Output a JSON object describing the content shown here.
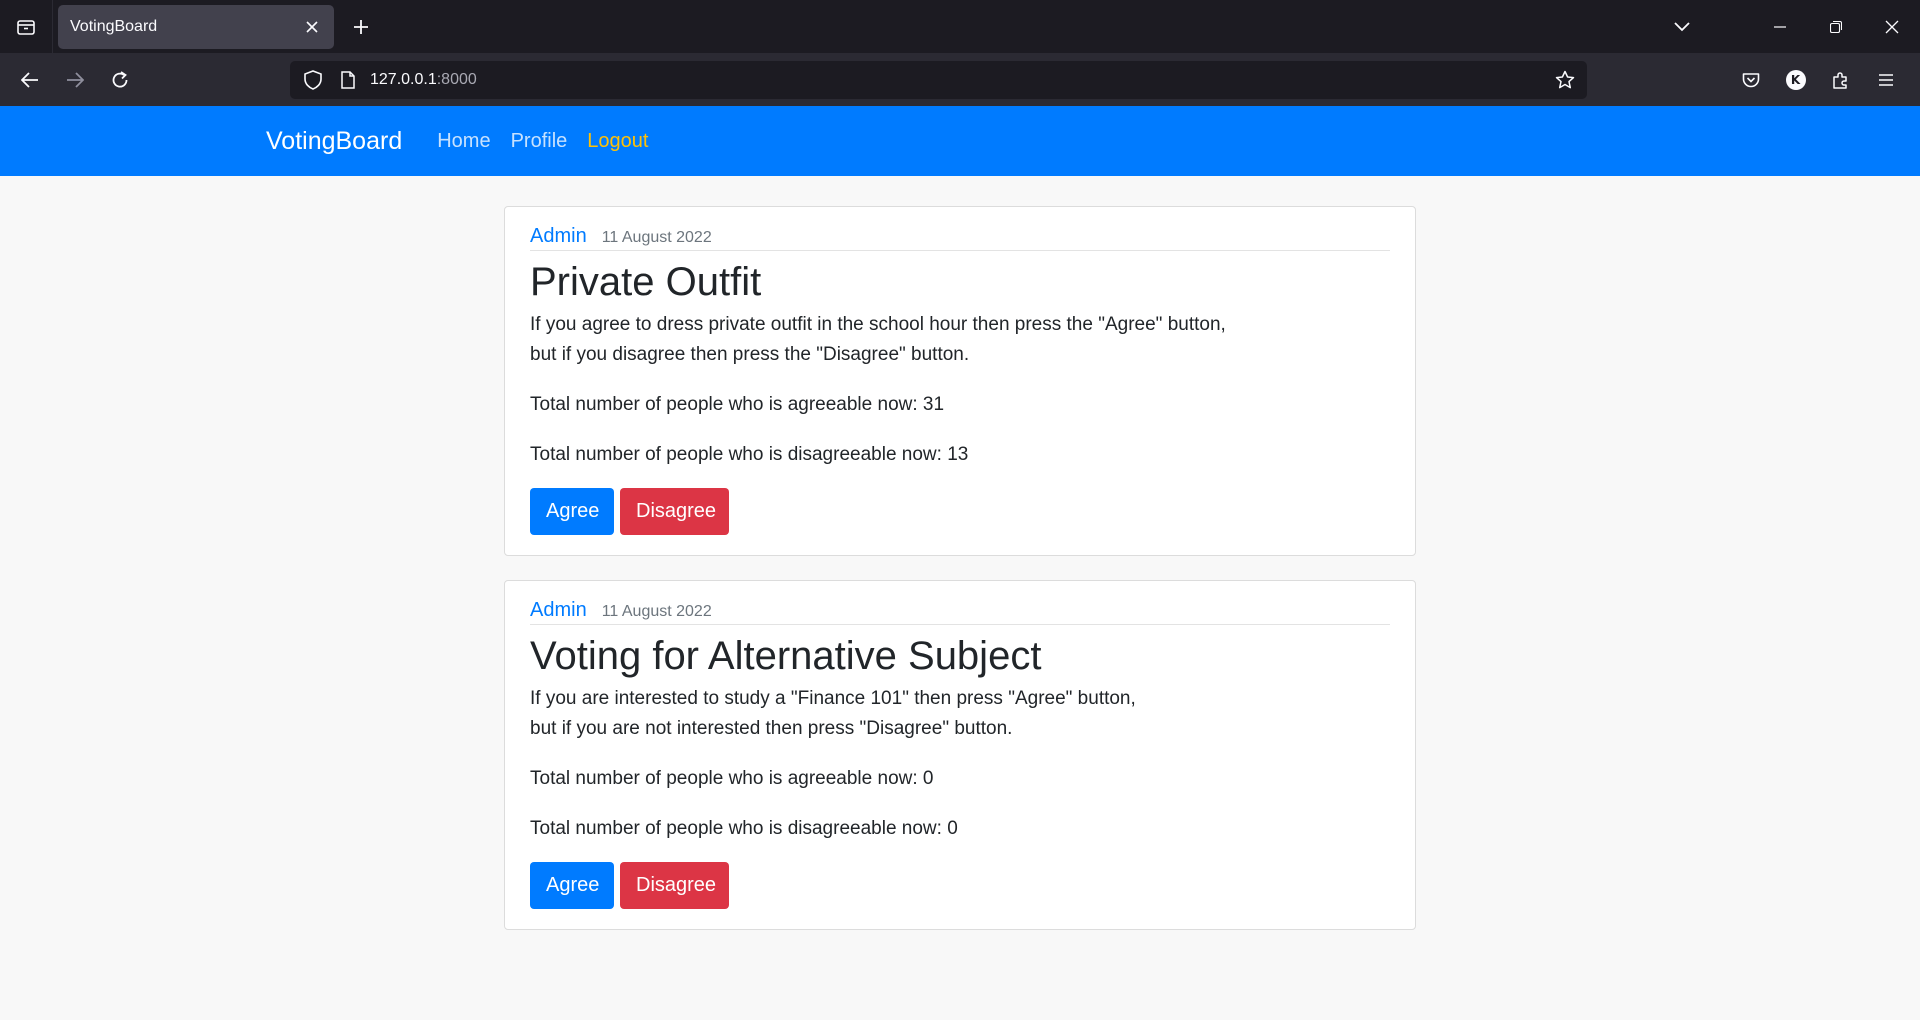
{
  "browser": {
    "tab_title": "VotingBoard",
    "url_host": "127.0.0.1",
    "url_port": ":8000",
    "profile_initial": "K"
  },
  "site": {
    "brand": "VotingBoard",
    "nav": {
      "home": "Home",
      "profile": "Profile",
      "logout": "Logout"
    }
  },
  "posts": [
    {
      "author": "Admin",
      "date": "11 August 2022",
      "title": "Private Outfit",
      "description_line1": "If you agree to dress private outfit in the school hour then press the \"Agree\" button,",
      "description_line2": "but if you disagree then press the \"Disagree\" button.",
      "agree_text": "Total number of people who is agreeable now: 31",
      "disagree_text": "Total number of people who is disagreeable now: 13",
      "agree_label": "Agree",
      "disagree_label": "Disagree"
    },
    {
      "author": "Admin",
      "date": "11 August 2022",
      "title": "Voting for Alternative Subject",
      "description_line1": "If you are interested to study a \"Finance 101\" then press \"Agree\" button,",
      "description_line2": "but if you are not interested then press \"Disagree\" button.",
      "agree_text": "Total number of people who is agreeable now: 0",
      "disagree_text": "Total number of people who is disagreeable now: 0",
      "agree_label": "Agree",
      "disagree_label": "Disagree"
    }
  ],
  "colors": {
    "primary": "#007bff",
    "danger": "#dc3545",
    "warning": "#ffc107"
  }
}
